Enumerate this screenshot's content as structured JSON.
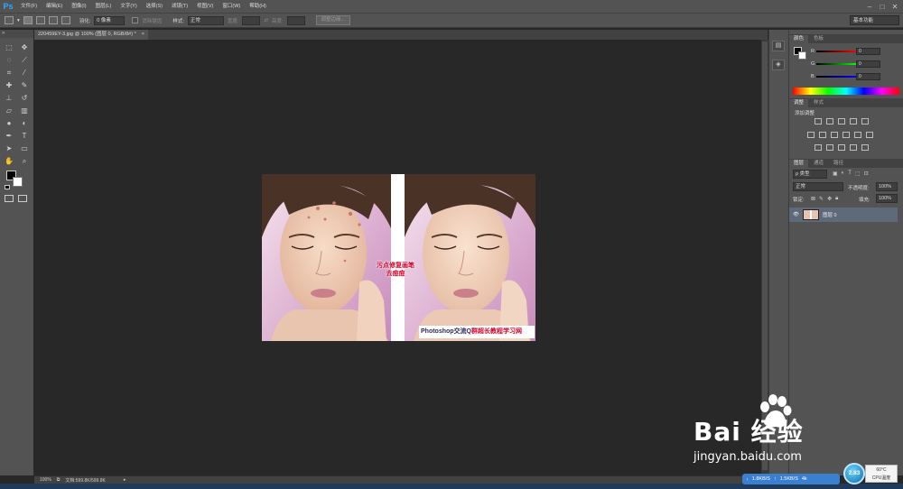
{
  "app": {
    "logo": "Ps"
  },
  "menu": [
    "文件(F)",
    "编辑(E)",
    "图像(I)",
    "图层(L)",
    "文字(Y)",
    "选择(S)",
    "滤镜(T)",
    "视图(V)",
    "窗口(W)",
    "帮助(H)"
  ],
  "window_controls": [
    "–",
    "□",
    "✕"
  ],
  "options": {
    "feather_label": "羽化:",
    "feather_value": "0 像素",
    "antialias_label": "消除锯齿",
    "style_label": "样式:",
    "style_value": "正常",
    "width_label": "宽度:",
    "height_label": "高度:",
    "refine_edge_button": "调整边缘..."
  },
  "workspace": {
    "value": "基本功能"
  },
  "document": {
    "tab_title": "220459EY-3.jpg @ 100% (图层 0, RGB/8#) *",
    "tab_close": "×",
    "overlay_line1": "污点修复画笔",
    "overlay_line2": "去痘痘",
    "watermark_prefix": "Photoshop交流Q",
    "watermark_suffix": "群超长教程学习网"
  },
  "status": {
    "zoom": "100%",
    "doc_size": "文档:599.8K/599.8K"
  },
  "color_panel": {
    "tabs": [
      "颜色",
      "色板"
    ],
    "channels": [
      {
        "label": "R",
        "value": "0"
      },
      {
        "label": "G",
        "value": "0"
      },
      {
        "label": "B",
        "value": "0"
      }
    ]
  },
  "adjustments_panel": {
    "tabs": [
      "调整",
      "样式"
    ],
    "add_label": "添加调整"
  },
  "layers_panel": {
    "tabs": [
      "图层",
      "通道",
      "路径"
    ],
    "kind_value": "ρ 类型",
    "blend_mode": "正常",
    "opacity_label": "不透明度:",
    "opacity_value": "100%",
    "lock_label": "锁定:",
    "fill_label": "填充:",
    "fill_value": "100%",
    "layer_name": "图层 0"
  },
  "taskbar": {
    "download": "1.8KB/S",
    "upload": "1.5KB/S",
    "net_extra": "4k",
    "cpu_value": "2.83",
    "cpu_temp": "60°C",
    "cpu_label": "CPU温度"
  },
  "watermark": {
    "brand": "Bai 经验",
    "url": "jingyan.baidu.com"
  },
  "colors": {
    "accent": "#31a8ff",
    "foreground": "#000000",
    "background": "#ffffff",
    "overlay_red": "#d4002a"
  }
}
